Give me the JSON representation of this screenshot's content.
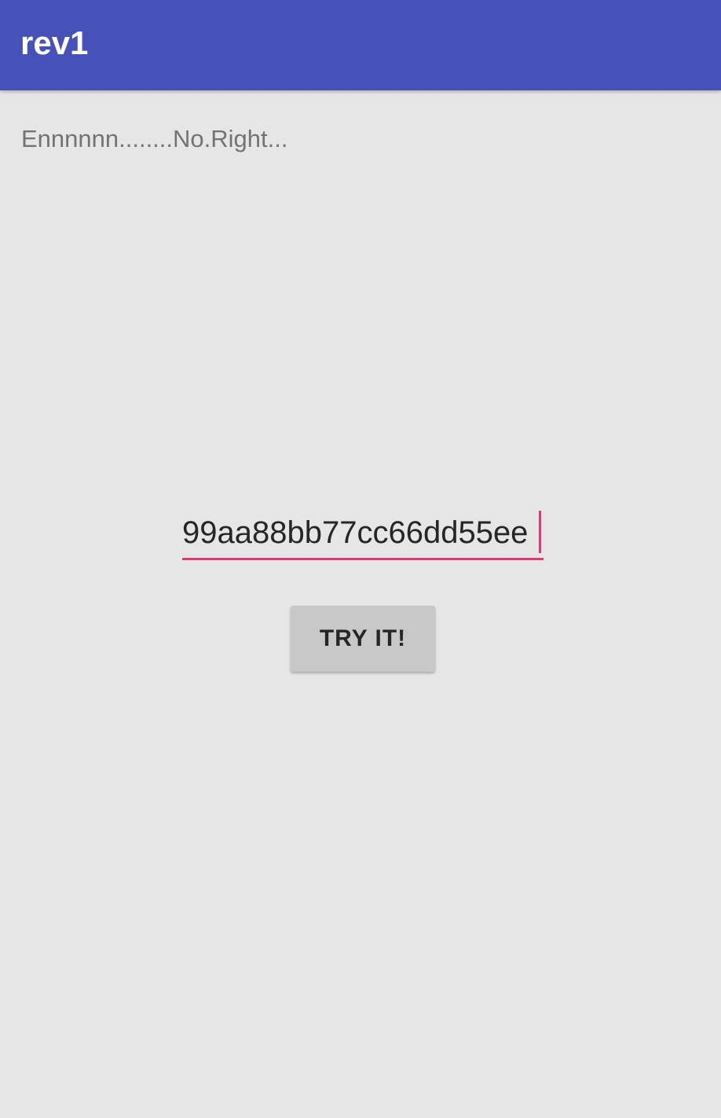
{
  "app_bar": {
    "title": "rev1",
    "background_color": "#4752b8"
  },
  "main": {
    "status_text": "Ennnnnn........No.Right...",
    "flag_input": {
      "value": "99aa88bb77cc66dd55ee",
      "accent_color": "#e0387a"
    },
    "try_button": {
      "label": "TRY IT!"
    }
  }
}
